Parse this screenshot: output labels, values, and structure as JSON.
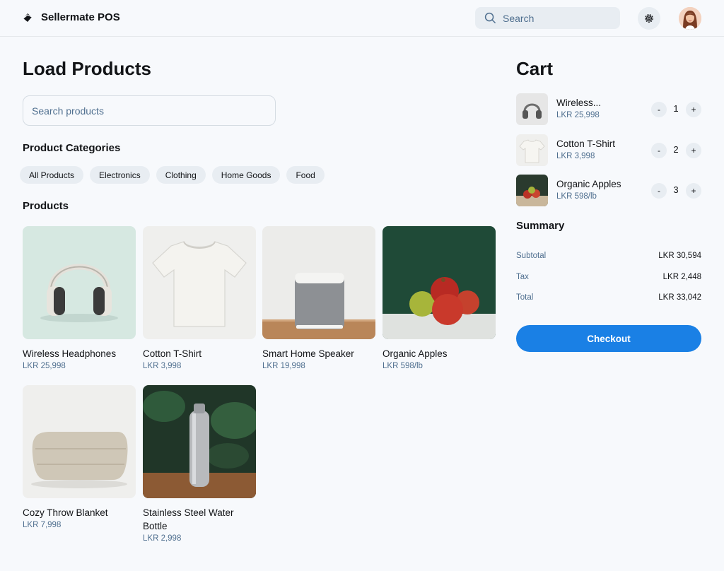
{
  "header": {
    "brand": "Sellermate POS",
    "search_placeholder": "Search"
  },
  "main": {
    "title": "Load Products",
    "search_placeholder": "Search products",
    "categories_title": "Product Categories",
    "categories": [
      "All Products",
      "Electronics",
      "Clothing",
      "Home Goods",
      "Food"
    ],
    "products_title": "Products",
    "products": [
      {
        "name": "Wireless Headphones",
        "price": "LKR 25,998",
        "image": "headphones"
      },
      {
        "name": "Cotton T-Shirt",
        "price": "LKR 3,998",
        "image": "tshirt"
      },
      {
        "name": "Smart Home Speaker",
        "price": "LKR 19,998",
        "image": "speaker"
      },
      {
        "name": "Organic Apples",
        "price": "LKR 598/lb",
        "image": "apples"
      },
      {
        "name": "Cozy Throw Blanket",
        "price": "LKR 7,998",
        "image": "blanket"
      },
      {
        "name": "Stainless Steel Water Bottle",
        "price": "LKR 2,998",
        "image": "bottle"
      }
    ]
  },
  "cart": {
    "title": "Cart",
    "items": [
      {
        "name": "Wireless...",
        "price": "LKR 25,998",
        "qty": "1",
        "image": "headphones"
      },
      {
        "name": "Cotton T-Shirt",
        "price": "LKR 3,998",
        "qty": "2",
        "image": "tshirt"
      },
      {
        "name": "Organic Apples",
        "price": "LKR 598/lb",
        "qty": "3",
        "image": "apples"
      }
    ],
    "minus_label": "-",
    "plus_label": "+",
    "summary_title": "Summary",
    "summary": [
      {
        "label": "Subtotal",
        "value": "LKR 30,594"
      },
      {
        "label": "Tax",
        "value": "LKR 2,448"
      },
      {
        "label": "Total",
        "value": "LKR 33,042"
      }
    ],
    "checkout_label": "Checkout"
  },
  "colors": {
    "accent": "#1a80e5",
    "background": "#f7f9fc",
    "chip": "#e8edf2",
    "muted_text": "#4f6f8f"
  }
}
